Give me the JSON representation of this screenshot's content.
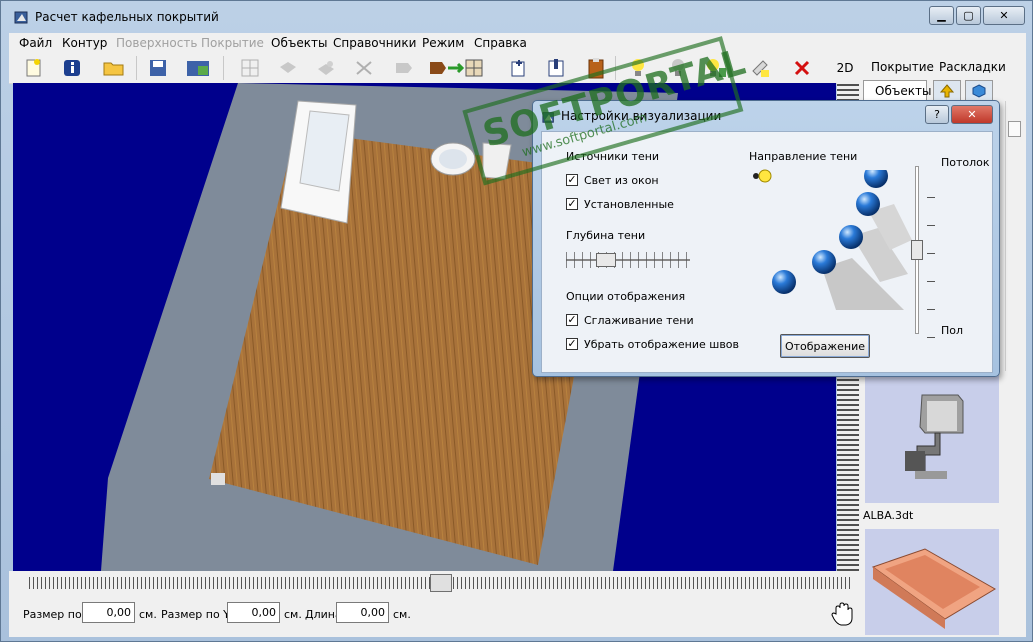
{
  "window": {
    "title": "Расчет кафельных покрытий"
  },
  "menu": [
    {
      "label": "Файл",
      "enabled": true
    },
    {
      "label": "Контур",
      "enabled": true
    },
    {
      "label": "Поверхность",
      "enabled": false
    },
    {
      "label": "Покрытие",
      "enabled": false
    },
    {
      "label": "Объекты",
      "enabled": true
    },
    {
      "label": "Справочники",
      "enabled": true
    },
    {
      "label": "Режим",
      "enabled": true
    },
    {
      "label": "Справка",
      "enabled": true
    }
  ],
  "toolbar": {
    "mode_2d": "2D"
  },
  "right_panel": {
    "tab_cover": "Покрытие",
    "tab_layout": "Раскладки",
    "tab_objects": "Объекты",
    "items": [
      "ALBA.3dt"
    ]
  },
  "dialog": {
    "title": "Настройки визуализации",
    "help": "?",
    "close": "✕",
    "shadow_sources": "Источники тени",
    "light_windows": "Свет из окон",
    "installed": "Установленные",
    "shadow_depth": "Глубина тени",
    "display_options": "Опции отображения",
    "smooth_shadow": "Сглаживание тени",
    "hide_seams": "Убрать отображение швов",
    "shadow_direction": "Направление тени",
    "ceiling": "Потолок",
    "floor": "Пол",
    "display_button": "Отображение",
    "checks": {
      "light_windows": true,
      "installed": true,
      "smooth_shadow": true,
      "hide_seams": true
    }
  },
  "bottom": {
    "size_x_label": "Размер по X",
    "size_x_value": "0,00",
    "unit1": "см.",
    "size_y_label": "Размер по Y",
    "size_y_value": "0,00",
    "unit2": "см.",
    "length_label": "Длина",
    "length_value": "0,00",
    "unit3": "см."
  },
  "watermark": {
    "line1": "SOFTPORTAL",
    "line2": "www.softportal.com"
  }
}
